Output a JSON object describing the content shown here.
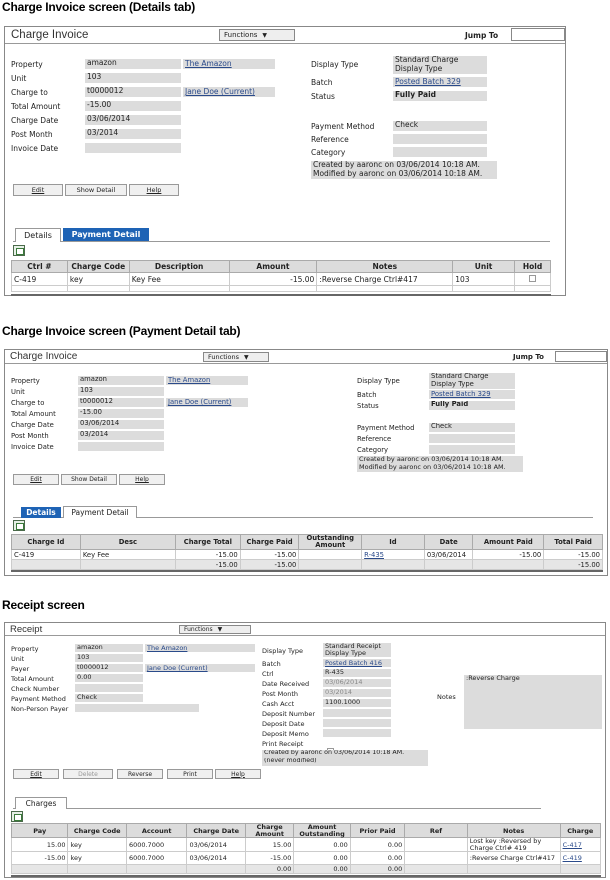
{
  "section1": {
    "heading": "Charge Invoice screen (Details tab)",
    "title": "Charge Invoice",
    "functions": "Functions",
    "jump_to": "Jump To",
    "fields": {
      "property_label": "Property",
      "property": "amazon",
      "property_link": "The Amazon",
      "unit_label": "Unit",
      "unit": "103",
      "charge_to_label": "Charge to",
      "charge_to": "t0000012",
      "charge_to_link": "Jane Doe (Current)",
      "total_amount_label": "Total Amount",
      "total_amount": "-15.00",
      "charge_date_label": "Charge Date",
      "charge_date": "03/06/2014",
      "post_month_label": "Post Month",
      "post_month": "03/2014",
      "invoice_date_label": "Invoice Date",
      "invoice_date": "",
      "display_type_label": "Display Type",
      "display_type_1": "Standard Charge",
      "display_type_2": "Display Type",
      "batch_label": "Batch",
      "batch": "Posted Batch 329",
      "status_label": "Status",
      "status": "Fully Paid",
      "payment_method_label": "Payment Method",
      "payment_method": "Check",
      "reference_label": "Reference",
      "reference": "",
      "category_label": "Category",
      "category": "",
      "created_by": "Created by aaronc on 03/06/2014 10:18 AM.",
      "modified_by": "Modified by aaronc on 03/06/2014 10:18 AM."
    },
    "buttons": {
      "edit": "Edit",
      "show_detail": "Show Detail",
      "help": "Help"
    },
    "tabs": {
      "details": "Details",
      "payment_detail": "Payment Detail"
    },
    "table": {
      "headers": [
        "Ctrl #",
        "Charge Code",
        "Description",
        "Amount",
        "Notes",
        "Unit",
        "Hold"
      ],
      "row": {
        "ctrl": "C-419",
        "code": "key",
        "desc": "Key Fee",
        "amount": "-15.00",
        "notes": ":Reverse Charge Ctrl#417",
        "unit": "103"
      }
    }
  },
  "section2": {
    "heading": "Charge Invoice screen (Payment Detail tab)",
    "title": "Charge Invoice",
    "functions": "Functions",
    "jump_to": "Jump To",
    "fields": {
      "property_label": "Property",
      "property": "amazon",
      "property_link": "The Amazon",
      "unit_label": "Unit",
      "unit": "103",
      "charge_to_label": "Charge to",
      "charge_to": "t0000012",
      "charge_to_link": "Jane Doe (Current)",
      "total_amount_label": "Total Amount",
      "total_amount": "-15.00",
      "charge_date_label": "Charge Date",
      "charge_date": "03/06/2014",
      "post_month_label": "Post Month",
      "post_month": "03/2014",
      "invoice_date_label": "Invoice Date",
      "invoice_date": "",
      "display_type_label": "Display Type",
      "display_type_1": "Standard Charge",
      "display_type_2": "Display Type",
      "batch_label": "Batch",
      "batch": "Posted Batch 329",
      "status_label": "Status",
      "status": "Fully Paid",
      "payment_method_label": "Payment Method",
      "payment_method": "Check",
      "reference_label": "Reference",
      "reference": "",
      "category_label": "Category",
      "category": "",
      "created_by": "Created by aaronc on 03/06/2014 10:18 AM.",
      "modified_by": "Modified by aaronc on 03/06/2014 10:18 AM."
    },
    "buttons": {
      "edit": "Edit",
      "show_detail": "Show Detail",
      "help": "Help"
    },
    "tabs": {
      "details": "Details",
      "payment_detail": "Payment Detail"
    },
    "table": {
      "headers": [
        "Charge Id",
        "Desc",
        "Charge Total",
        "Charge Paid",
        "Outstanding Amount",
        "Id",
        "Date",
        "Amount Paid",
        "Total Paid"
      ],
      "row": {
        "charge_id": "C-419",
        "desc": "Key Fee",
        "charge_total": "-15.00",
        "charge_paid": "-15.00",
        "outstanding": "",
        "id": "R-435",
        "date": "03/06/2014",
        "amount_paid": "-15.00",
        "total_paid": "-15.00"
      },
      "total": {
        "charge_total": "-15.00",
        "charge_paid": "-15.00",
        "total_paid": "-15.00"
      }
    }
  },
  "section3": {
    "heading": "Receipt screen",
    "title": "Receipt",
    "functions": "Functions",
    "fields": {
      "property_label": "Property",
      "property": "amazon",
      "property_link": "The Amazon",
      "unit_label": "Unit",
      "unit": "103",
      "payer_label": "Payer",
      "payer": "t0000012",
      "payer_link": "Jane Doe (Current)",
      "total_amount_label": "Total Amount",
      "total_amount": "0.00",
      "check_number_label": "Check Number",
      "check_number": "",
      "payment_method_label": "Payment Method",
      "payment_method": "Check",
      "non_person_payer_label": "Non-Person Payer",
      "non_person_payer": "",
      "display_type_label": "Display Type",
      "display_type_1": "Standard Receipt",
      "display_type_2": "Display Type",
      "batch_label": "Batch",
      "batch": "Posted Batch 416",
      "ctrl_label": "Ctrl",
      "ctrl": "R-435",
      "date_received_label": "Date Received",
      "date_received": "03/06/2014",
      "post_month_label": "Post Month",
      "post_month": "03/2014",
      "cash_acct_label": "Cash Acct",
      "cash_acct": "1100.1000",
      "deposit_number_label": "Deposit Number",
      "deposit_number": "",
      "deposit_date_label": "Deposit Date",
      "deposit_date": "",
      "deposit_memo_label": "Deposit Memo",
      "deposit_memo": "",
      "print_receipt_label": "Print Receipt",
      "created_by": "Created by aaronc on 03/06/2014 10:18 AM.",
      "never_modified": "(never modified)",
      "notes_label": "Notes",
      "notes": ":Reverse Charge"
    },
    "buttons": {
      "edit": "Edit",
      "delete": "Delete",
      "reverse": "Reverse",
      "print": "Print",
      "help": "Help"
    },
    "tabs": {
      "charges": "Charges"
    },
    "table": {
      "headers": [
        "Pay",
        "Charge Code",
        "Account",
        "Charge Date",
        "Charge Amount",
        "Amount Outstanding",
        "Prior Paid",
        "Ref",
        "Notes",
        "Charge"
      ],
      "rows": [
        {
          "pay": "15.00",
          "code": "key",
          "account": "6000.7000",
          "date": "03/06/2014",
          "amount": "15.00",
          "outstanding": "0.00",
          "prior": "0.00",
          "ref": "",
          "notes": "Lost key :Reversed by Charge Ctrl# 419",
          "charge": "C-417"
        },
        {
          "pay": "-15.00",
          "code": "key",
          "account": "6000.7000",
          "date": "03/06/2014",
          "amount": "-15.00",
          "outstanding": "0.00",
          "prior": "0.00",
          "ref": "",
          "notes": ":Reverse Charge Ctrl#417",
          "charge": "C-419"
        }
      ],
      "total": {
        "amount": "0.00",
        "outstanding": "0.00",
        "prior": "0.00"
      }
    }
  }
}
